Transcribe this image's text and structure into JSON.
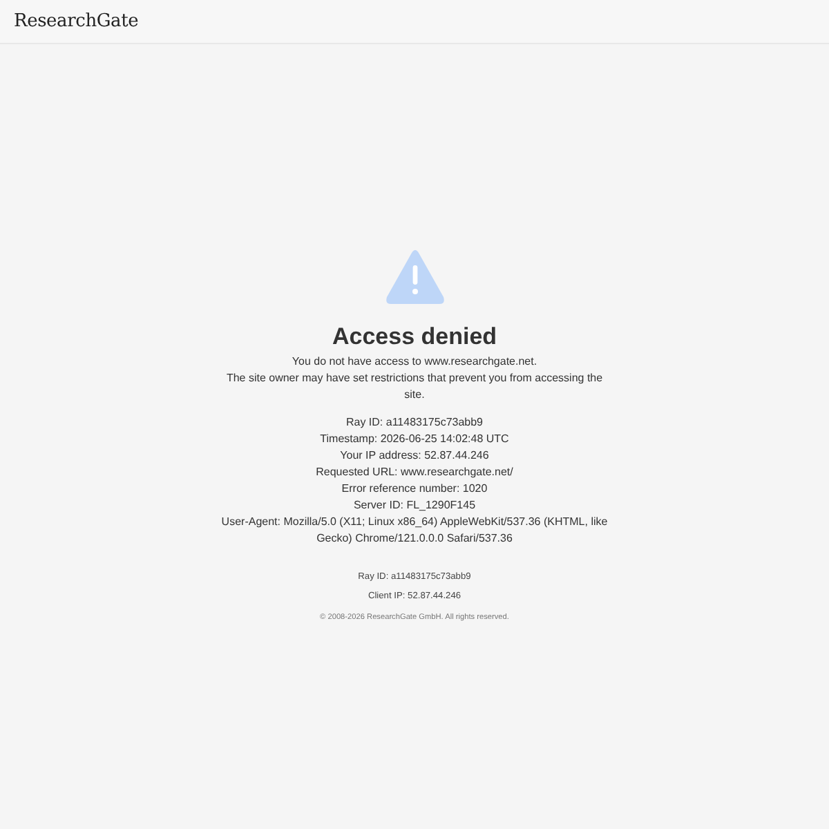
{
  "header": {
    "logo": "ResearchGate"
  },
  "alert": {
    "kind": "warning",
    "title": "Access denied",
    "message": [
      "You do not have access to www.researchgate.net.",
      "The site owner may have set restrictions that prevent you from accessing the site."
    ]
  },
  "details": [
    "Ray ID: a11483175c73abb9",
    "Timestamp: 2026-06-25 14:02:48 UTC",
    "Your IP address: 52.87.44.246",
    "Requested URL: www.researchgate.net/",
    "Error reference number: 1020",
    "Server ID: FL_1290F145",
    "User-Agent: Mozilla/5.0 (X11; Linux x86_64) AppleWebKit/537.36 (KHTML, like Gecko) Chrome/121.0.0.0 Safari/537.36"
  ],
  "footer": {
    "lines": [
      "Ray ID: a11483175c73abb9",
      "Client IP: 52.87.44.246"
    ],
    "copyright": "© 2008-2026 ResearchGate GmbH. All rights reserved."
  }
}
